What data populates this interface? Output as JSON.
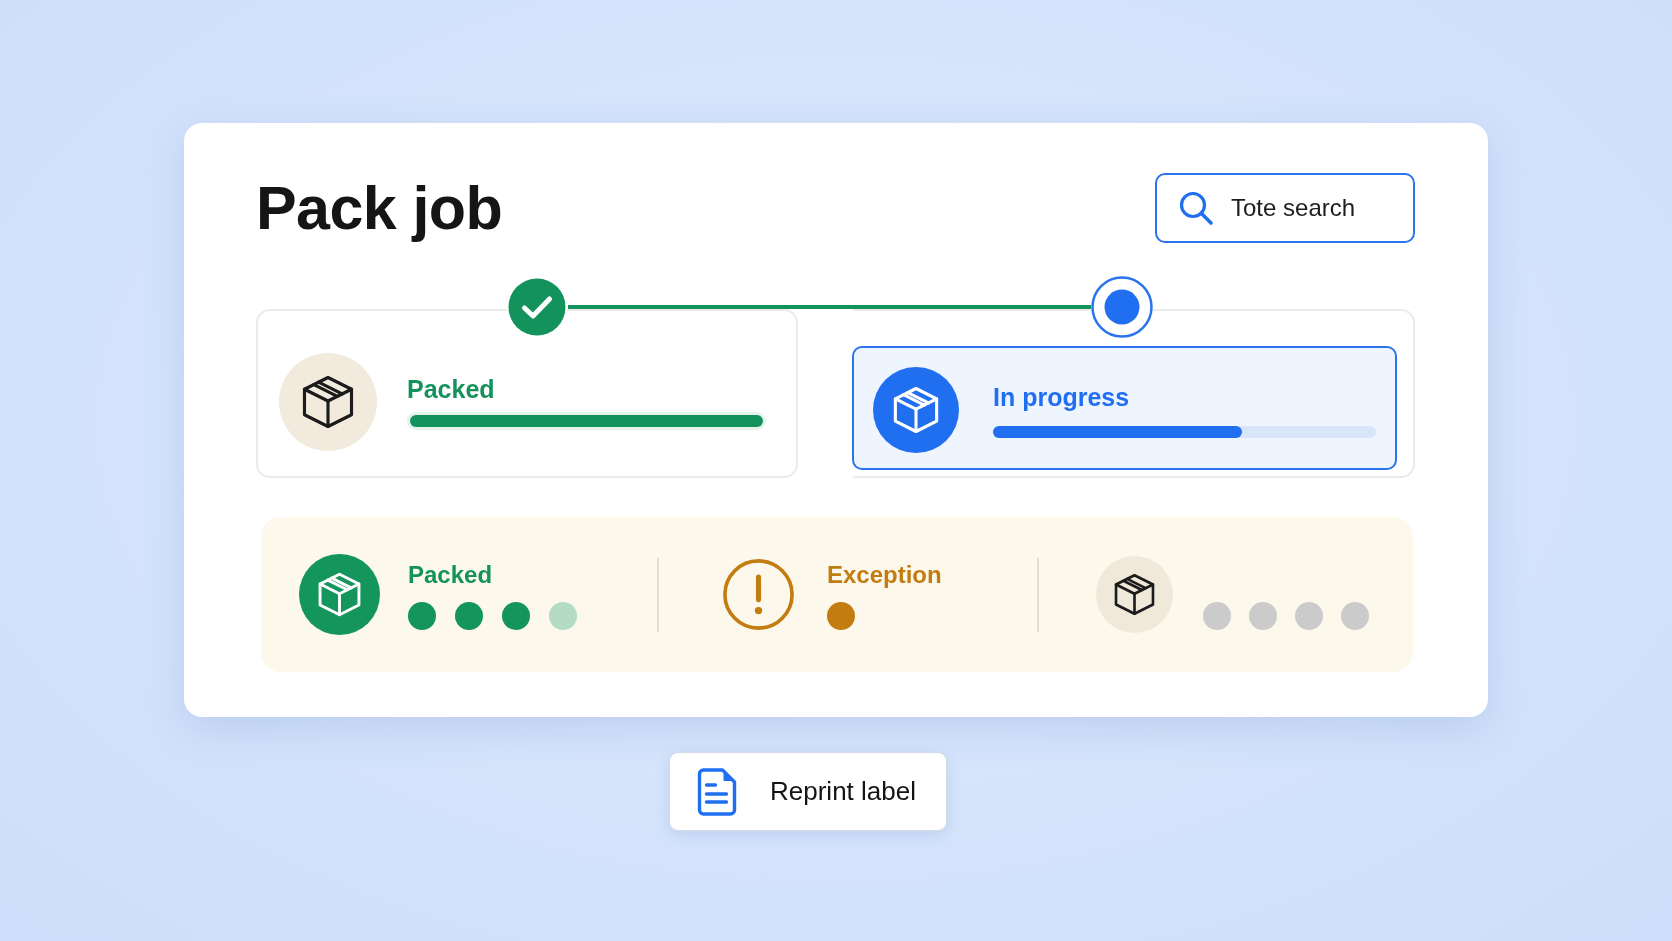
{
  "title": "Pack job",
  "search": {
    "placeholder": "Tote search"
  },
  "steps": [
    {
      "kind": "done",
      "label": "Packed",
      "level": 1
    },
    {
      "kind": "current",
      "label": "In progress",
      "level": 0.65
    }
  ],
  "summary": [
    {
      "kind": "packed",
      "label": "Packed",
      "dots": [
        {
          "color": "#14955c"
        },
        {
          "color": "#14955c"
        },
        {
          "color": "#14955c"
        },
        {
          "color": "#b4dbc3"
        }
      ]
    },
    {
      "kind": "exception",
      "label": "Exception",
      "dots": [
        {
          "color": "#c27c10"
        }
      ]
    },
    {
      "kind": "pending",
      "dots": [
        {
          "color": "#cbcbcb"
        },
        {
          "color": "#cbcbcb"
        },
        {
          "color": "#cbcbcb"
        },
        {
          "color": "#cbcbcb"
        }
      ]
    }
  ],
  "reprint_button": {
    "label": "Reprint label"
  }
}
